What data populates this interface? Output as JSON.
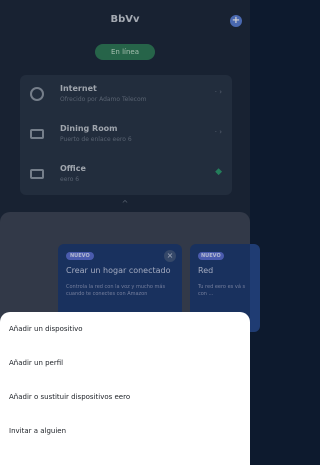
{
  "header": {
    "title": "BbVv"
  },
  "status": {
    "label": "En línea",
    "color": "#2f7a59"
  },
  "devices": [
    {
      "name": "Internet",
      "sub": "Ofrecido por Adamo Telecom",
      "right": "· ›",
      "icon": "router-icon"
    },
    {
      "name": "Dining Room",
      "sub": "Puerto de enlace eero 6",
      "right": "· ›",
      "icon": "eero-device-icon"
    },
    {
      "name": "Office",
      "sub": "eero 6",
      "right": "wifi",
      "icon": "eero-device-icon"
    }
  ],
  "promo": {
    "badge": "NUEVO",
    "title": "Crear un hogar conectado",
    "body": "Controla la red con la voz y mucho más cuando te conectes con Amazon",
    "second_badge": "NUEVO",
    "second_title": "Red",
    "second_body": "Tu red eero es vá s con ..."
  },
  "sheet": {
    "items": [
      "Añadir un dispositivo",
      "Añadir un perfil",
      "Añadir o sustituir dispositivos eero",
      "Invitar a alguien"
    ]
  },
  "colors": {
    "accent": "#5a7fd6",
    "sheet_bg": "#ffffff",
    "background": "#1e2a3e"
  }
}
